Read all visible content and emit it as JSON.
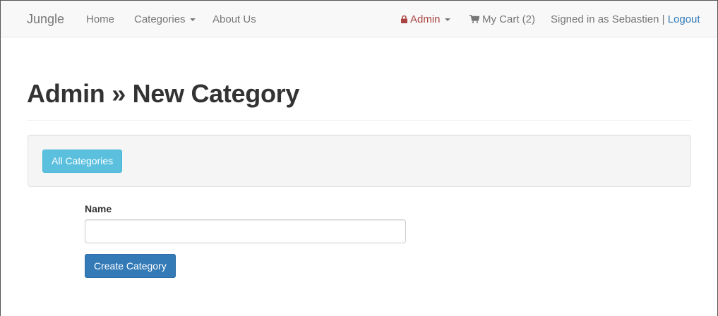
{
  "navbar": {
    "brand": "Jungle",
    "home": "Home",
    "categories": "Categories",
    "about": "About Us",
    "admin": "Admin",
    "cart": "My Cart (2)",
    "signed_in": "Signed in as Sebastien |",
    "logout": "Logout"
  },
  "page": {
    "title": "Admin » New Category"
  },
  "toolbar": {
    "all_categories": "All Categories"
  },
  "form": {
    "name_label": "Name",
    "name_value": "",
    "name_placeholder": "",
    "submit_label": "Create Category"
  },
  "colors": {
    "admin": "#a94442",
    "link": "#337ab7",
    "info_button": "#5bc0de",
    "primary_button": "#337ab7"
  }
}
